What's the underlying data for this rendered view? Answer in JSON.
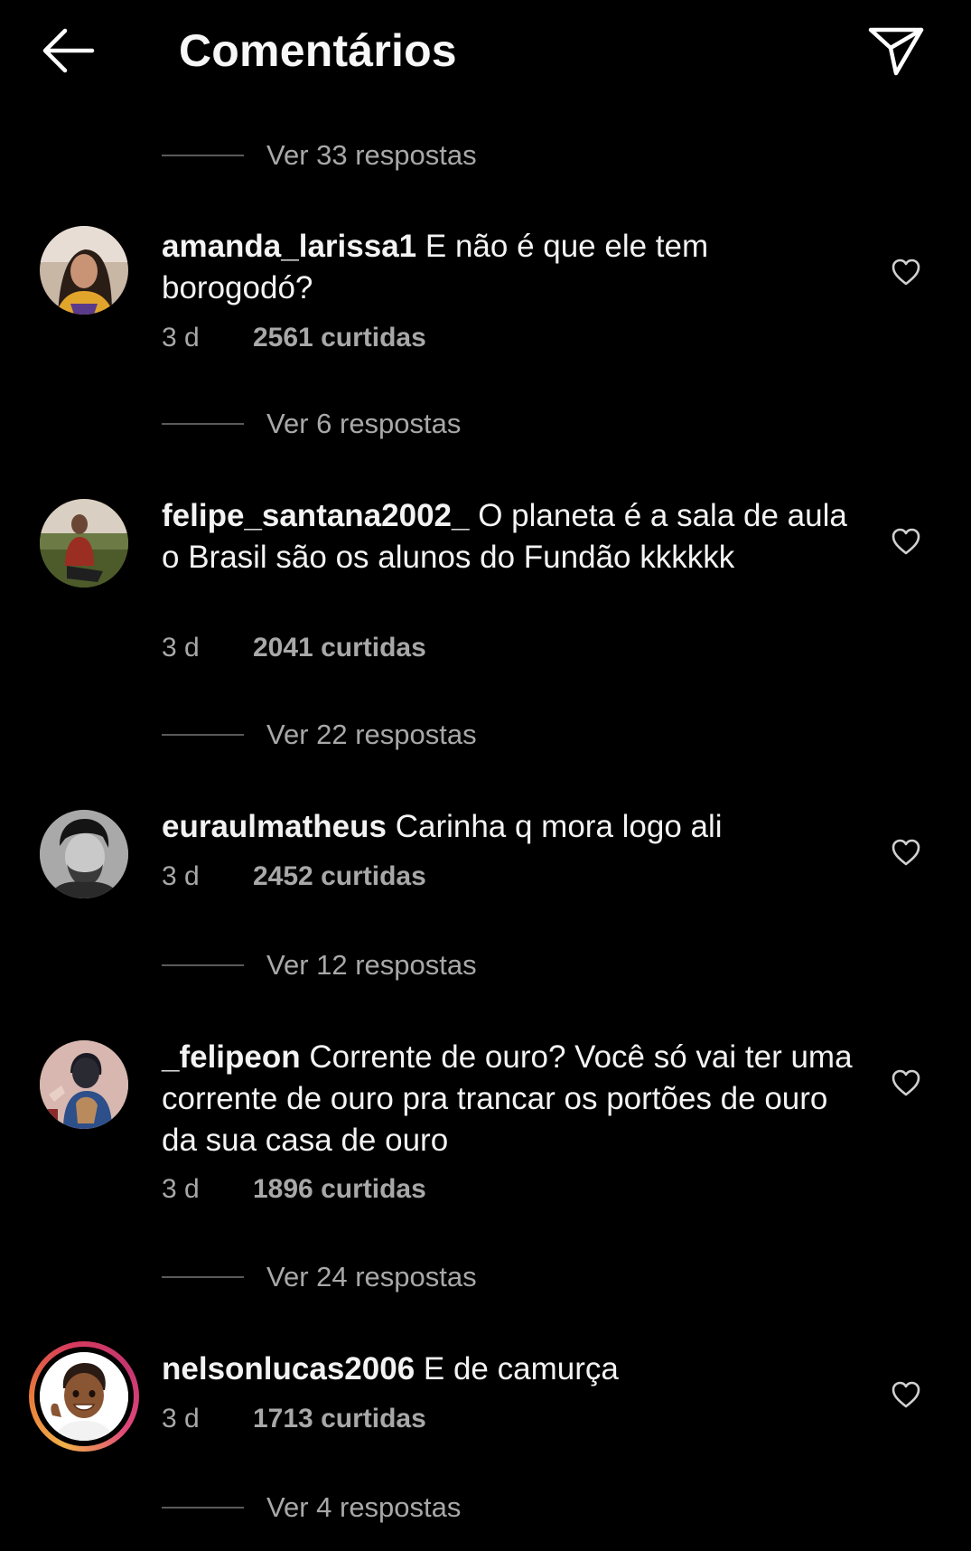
{
  "header": {
    "title": "Comentários",
    "back_icon": "arrow-left-icon",
    "share_icon": "paper-plane-icon"
  },
  "thread_top": {
    "replies_label": "Ver 33 respostas"
  },
  "comments": [
    {
      "username": "amanda_larissa1",
      "text": "E não é que ele tem borogodó?",
      "time": "3 d",
      "likes": "2561 curtidas",
      "replies_label": "Ver 6 respostas"
    },
    {
      "username": "felipe_santana2002_",
      "text": "O planeta é a sala de aula o Brasil são os alunos do Fundão kkkkkk",
      "time": "3 d",
      "likes": "2041 curtidas",
      "replies_label": "Ver 22 respostas"
    },
    {
      "username": "euraulmatheus",
      "text": "Carinha q mora logo ali",
      "time": "3 d",
      "likes": "2452 curtidas",
      "replies_label": "Ver 12 respostas"
    },
    {
      "username": "_felipeon",
      "text": "Corrente de ouro? Você só vai ter uma corrente de ouro pra trancar os portões de ouro da sua casa de ouro",
      "time": "3 d",
      "likes": "1896 curtidas",
      "replies_label": "Ver 24 respostas"
    },
    {
      "username": "nelsonlucas2006",
      "text": "E de camurça",
      "time": "3 d",
      "likes": "1713 curtidas",
      "replies_label": "Ver 4 respostas"
    }
  ],
  "colors": {
    "background": "#000000",
    "text_primary": "#f3f3f3",
    "text_secondary": "#a8a8a8",
    "divider": "#5a5a5a",
    "story_ring_start": "#f0b04a",
    "story_ring_end": "#d83b5d"
  },
  "icons": {
    "like": "heart-outline-icon"
  }
}
